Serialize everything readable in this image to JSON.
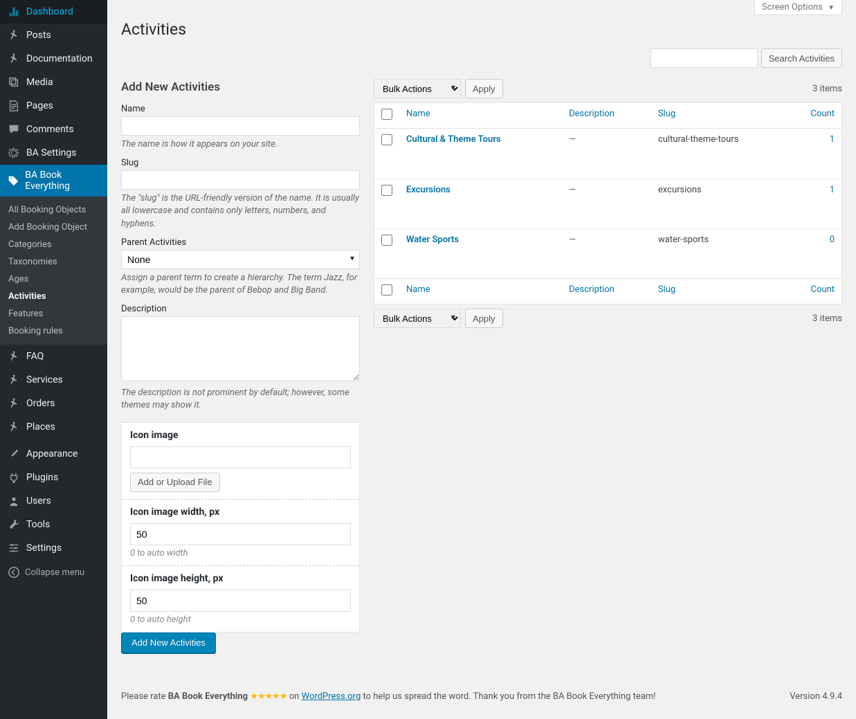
{
  "screen_options": "Screen Options",
  "page_title": "Activities",
  "sidebar": {
    "items": [
      {
        "label": "Dashboard",
        "icon": "dashboard"
      },
      {
        "label": "Posts",
        "icon": "pin"
      },
      {
        "label": "Documentation",
        "icon": "pin"
      },
      {
        "label": "Media",
        "icon": "media"
      },
      {
        "label": "Pages",
        "icon": "page"
      },
      {
        "label": "Comments",
        "icon": "comment"
      },
      {
        "label": "BA Settings",
        "icon": "gear"
      },
      {
        "label": "BA Book Everything",
        "icon": "tag",
        "active": true,
        "submenu": [
          {
            "label": "All Booking Objects"
          },
          {
            "label": "Add Booking Object"
          },
          {
            "label": "Categories"
          },
          {
            "label": "Taxonomies"
          },
          {
            "label": "Ages"
          },
          {
            "label": "Activities",
            "active": true
          },
          {
            "label": "Features"
          },
          {
            "label": "Booking rules"
          }
        ]
      },
      {
        "label": "FAQ",
        "icon": "pin"
      },
      {
        "label": "Services",
        "icon": "pin"
      },
      {
        "label": "Orders",
        "icon": "pin"
      },
      {
        "label": "Places",
        "icon": "pin"
      },
      {
        "label": "Appearance",
        "icon": "brush",
        "sep_before": true
      },
      {
        "label": "Plugins",
        "icon": "plug"
      },
      {
        "label": "Users",
        "icon": "user"
      },
      {
        "label": "Tools",
        "icon": "wrench"
      },
      {
        "label": "Settings",
        "icon": "sliders"
      }
    ],
    "collapse": "Collapse menu"
  },
  "search": {
    "button": "Search Activities"
  },
  "bulk": {
    "label": "Bulk Actions",
    "apply": "Apply"
  },
  "items_count": "3 items",
  "form": {
    "title": "Add New Activities",
    "name_label": "Name",
    "name_help": "The name is how it appears on your site.",
    "slug_label": "Slug",
    "slug_help": "The \"slug\" is the URL-friendly version of the name. It is usually all lowercase and contains only letters, numbers, and hyphens.",
    "parent_label": "Parent Activities",
    "parent_value": "None",
    "parent_help": "Assign a parent term to create a hierarchy. The term Jazz, for example, would be the parent of Bebop and Big Band.",
    "desc_label": "Description",
    "desc_help": "The description is not prominent by default; however, some themes may show it.",
    "icon_label": "Icon image",
    "upload_button": "Add or Upload File",
    "width_label": "Icon image width, px",
    "width_value": "50",
    "width_help": "0 to auto width",
    "height_label": "Icon image height, px",
    "height_value": "50",
    "height_help": "0 to auto height",
    "submit": "Add New Activities"
  },
  "table": {
    "cols": {
      "name": "Name",
      "desc": "Description",
      "slug": "Slug",
      "count": "Count"
    },
    "rows": [
      {
        "name": "Cultural & Theme Tours",
        "desc": "—",
        "slug": "cultural-theme-tours",
        "count": "1"
      },
      {
        "name": "Excursions",
        "desc": "—",
        "slug": "excursions",
        "count": "1"
      },
      {
        "name": "Water Sports",
        "desc": "—",
        "slug": "water-sports",
        "count": "0"
      }
    ]
  },
  "footer": {
    "text1": "Please rate ",
    "product": "BA Book Everything",
    "stars": "★★★★★",
    "text2": " on ",
    "link": "WordPress.org",
    "text3": " to help us spread the word. Thank you from the BA Book Everything team!",
    "version": "Version 4.9.4"
  }
}
